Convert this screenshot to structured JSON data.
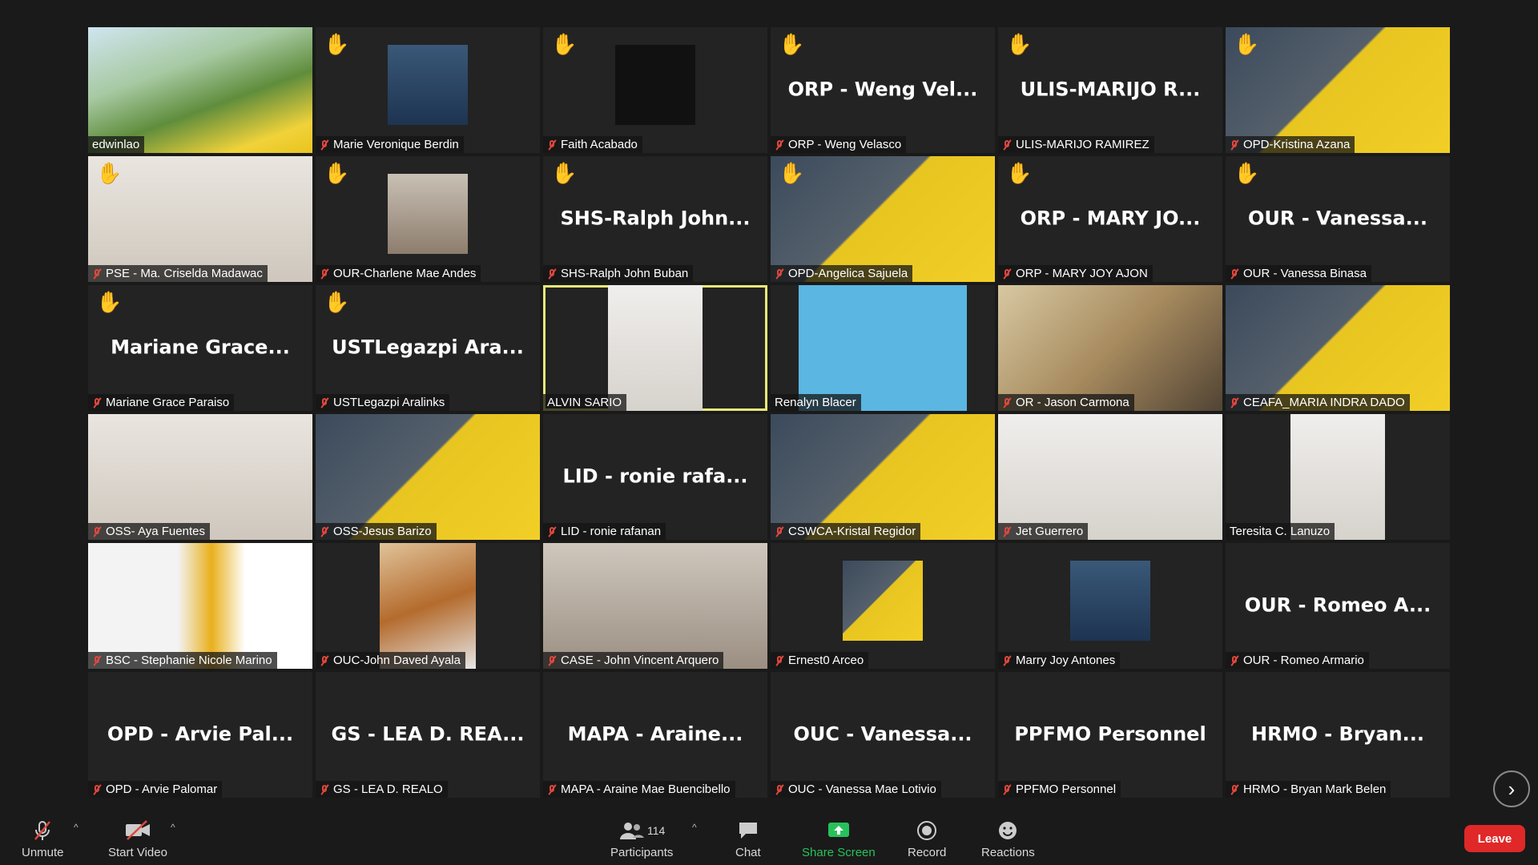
{
  "participants_tiles": [
    {
      "name": "edwinlao",
      "display": "",
      "hand": false,
      "muted": false,
      "bg": "bg-green",
      "photo": false,
      "active": false
    },
    {
      "name": "Marie Veronique Berdin",
      "display": "",
      "hand": true,
      "muted": true,
      "bg": "bg-portrait",
      "photo": true,
      "active": false
    },
    {
      "name": "Faith Acabado",
      "display": "",
      "hand": true,
      "muted": true,
      "bg": "bg-black",
      "photo": true,
      "active": false
    },
    {
      "name": "ORP - Weng Velasco",
      "display": "ORP - Weng Vel...",
      "hand": true,
      "muted": true,
      "bg": "",
      "photo": false,
      "active": false
    },
    {
      "name": "ULIS-MARIJO RAMIREZ",
      "display": "ULIS-MARIJO R...",
      "hand": true,
      "muted": true,
      "bg": "",
      "photo": false,
      "active": false
    },
    {
      "name": "OPD-Kristina Azana",
      "display": "",
      "hand": true,
      "muted": true,
      "bg": "bg-yellow",
      "photo": false,
      "active": false
    },
    {
      "name": "PSE - Ma. Criselda Madawac",
      "display": "",
      "hand": true,
      "muted": true,
      "bg": "bg-room",
      "photo": false,
      "active": false
    },
    {
      "name": "OUR-Charlene Mae Andes",
      "display": "",
      "hand": true,
      "muted": true,
      "bg": "bg-portrait2",
      "photo": true,
      "active": false
    },
    {
      "name": "SHS-Ralph John Buban",
      "display": "SHS-Ralph John...",
      "hand": true,
      "muted": true,
      "bg": "",
      "photo": false,
      "active": false
    },
    {
      "name": "OPD-Angelica Sajuela",
      "display": "",
      "hand": true,
      "muted": true,
      "bg": "bg-yellow",
      "photo": false,
      "active": false
    },
    {
      "name": "ORP - MARY JOY AJON",
      "display": "ORP - MARY JO...",
      "hand": true,
      "muted": true,
      "bg": "",
      "photo": false,
      "active": false
    },
    {
      "name": "OUR - Vanessa Binasa",
      "display": "OUR - Vanessa...",
      "hand": true,
      "muted": true,
      "bg": "",
      "photo": false,
      "active": false
    },
    {
      "name": "Mariane Grace Paraiso",
      "display": "Mariane Grace...",
      "hand": true,
      "muted": true,
      "bg": "",
      "photo": false,
      "active": false
    },
    {
      "name": "USTLegazpi Aralinks",
      "display": "USTLegazpi Ara...",
      "hand": true,
      "muted": true,
      "bg": "",
      "photo": false,
      "active": false
    },
    {
      "name": "ALVIN SARIO",
      "display": "",
      "hand": false,
      "muted": false,
      "bg": "bg-bright",
      "photo": true,
      "active": true
    },
    {
      "name": "Renalyn Blacer",
      "display": "",
      "hand": false,
      "muted": false,
      "bg": "bg-sky",
      "photo": true,
      "active": false
    },
    {
      "name": "OR - Jason Carmona",
      "display": "",
      "hand": false,
      "muted": true,
      "bg": "bg-church",
      "photo": false,
      "active": false
    },
    {
      "name": "CEAFA_MARIA INDRA DADO",
      "display": "",
      "hand": false,
      "muted": true,
      "bg": "bg-yellow",
      "photo": false,
      "active": false
    },
    {
      "name": "OSS- Aya Fuentes",
      "display": "",
      "hand": false,
      "muted": true,
      "bg": "bg-room",
      "photo": false,
      "active": false
    },
    {
      "name": "OSS-Jesus Barizo",
      "display": "",
      "hand": false,
      "muted": true,
      "bg": "bg-yellow",
      "photo": false,
      "active": false
    },
    {
      "name": "LID - ronie rafanan",
      "display": "LID - ronie rafa...",
      "hand": false,
      "muted": true,
      "bg": "",
      "photo": false,
      "active": false
    },
    {
      "name": "CSWCA-Kristal Regidor",
      "display": "",
      "hand": false,
      "muted": true,
      "bg": "bg-yellow",
      "photo": false,
      "active": false
    },
    {
      "name": "Jet Guerrero",
      "display": "",
      "hand": false,
      "muted": true,
      "bg": "bg-bright",
      "photo": false,
      "active": false
    },
    {
      "name": "Teresita C. Lanuzo",
      "display": "",
      "hand": false,
      "muted": false,
      "bg": "bg-bright",
      "photo": true,
      "active": false
    },
    {
      "name": "BSC - Stephanie Nicole Marino",
      "display": "",
      "hand": false,
      "muted": true,
      "bg": "bg-logo",
      "photo": false,
      "active": false
    },
    {
      "name": "OUC-John Daved Ayala",
      "display": "",
      "hand": false,
      "muted": true,
      "bg": "bg-classroom",
      "photo": true,
      "active": false
    },
    {
      "name": "CASE - John Vincent Arquero",
      "display": "",
      "hand": false,
      "muted": true,
      "bg": "bg-cafe",
      "photo": false,
      "active": false
    },
    {
      "name": "Ernest0 Arceo",
      "display": "",
      "hand": false,
      "muted": true,
      "bg": "bg-yellow",
      "photo": true,
      "active": false
    },
    {
      "name": "Marry Joy Antones",
      "display": "",
      "hand": false,
      "muted": true,
      "bg": "bg-portrait",
      "photo": true,
      "active": false
    },
    {
      "name": "OUR - Romeo Armario",
      "display": "OUR - Romeo A...",
      "hand": false,
      "muted": true,
      "bg": "",
      "photo": false,
      "active": false
    },
    {
      "name": "OPD - Arvie Palomar",
      "display": "OPD - Arvie Pal...",
      "hand": false,
      "muted": true,
      "bg": "",
      "photo": false,
      "active": false
    },
    {
      "name": "GS - LEA D. REALO",
      "display": "GS - LEA D. REA...",
      "hand": false,
      "muted": true,
      "bg": "",
      "photo": false,
      "active": false
    },
    {
      "name": "MAPA - Araine Mae Buencibello",
      "display": "MAPA - Araine...",
      "hand": false,
      "muted": true,
      "bg": "",
      "photo": false,
      "active": false
    },
    {
      "name": "OUC - Vanessa Mae Lotivio",
      "display": "OUC - Vanessa...",
      "hand": false,
      "muted": true,
      "bg": "",
      "photo": false,
      "active": false
    },
    {
      "name": "PPFMO Personnel",
      "display": "PPFMO Personnel",
      "hand": false,
      "muted": true,
      "bg": "",
      "photo": false,
      "active": false
    },
    {
      "name": "HRMO - Bryan Mark Belen",
      "display": "HRMO - Bryan...",
      "hand": false,
      "muted": true,
      "bg": "",
      "photo": false,
      "active": false
    }
  ],
  "toolbar": {
    "unmute_label": "Unmute",
    "start_video_label": "Start Video",
    "participants_label": "Participants",
    "participants_count": "114",
    "chat_label": "Chat",
    "share_screen_label": "Share Screen",
    "record_label": "Record",
    "reactions_label": "Reactions",
    "leave_label": "Leave"
  },
  "colors": {
    "share_green": "#27c15a",
    "leave_red": "#e02828",
    "muted_red": "#e0473d",
    "active_outline": "#e6e87a"
  }
}
